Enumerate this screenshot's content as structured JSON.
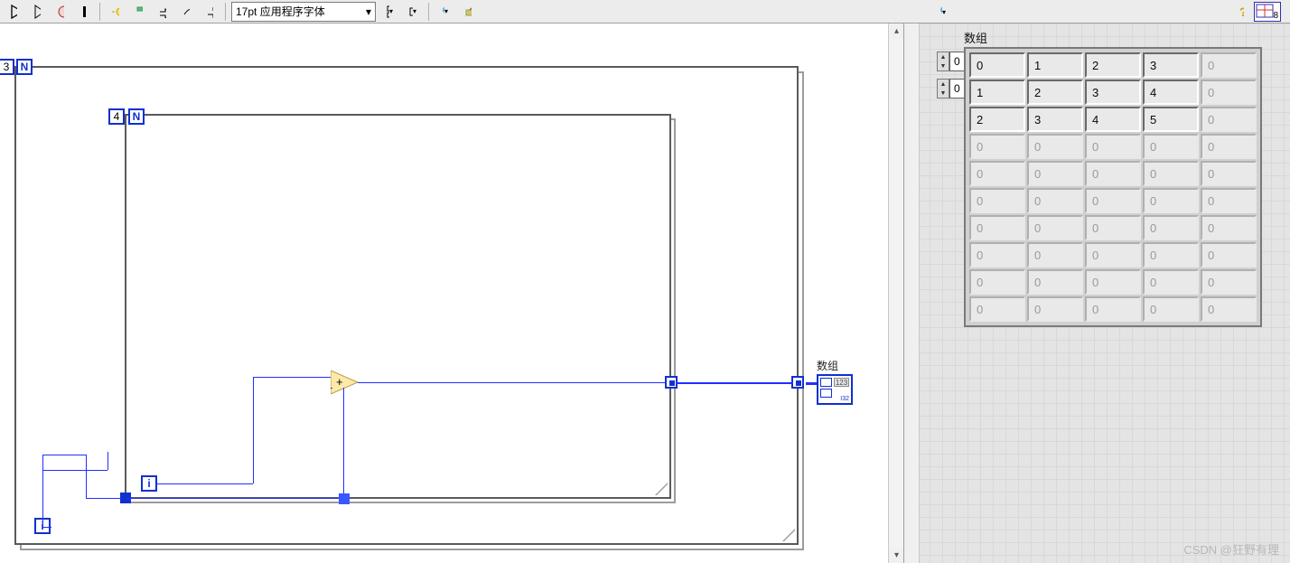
{
  "toolbar": {
    "font_selector": "17pt 应用程序字体",
    "badge_value": "8"
  },
  "diagram": {
    "outer_N_const": "3",
    "outer_N": "N",
    "outer_i": "i",
    "inner_N_const": "4",
    "inner_N": "N",
    "inner_i": "i",
    "add_op": "+",
    "indicator_label": "数组",
    "indicator_cell": "123",
    "indicator_sig": "I32"
  },
  "panel": {
    "array_label": "数组",
    "index_values": [
      "0",
      "0"
    ],
    "cols": 5,
    "rows": 10,
    "active_rows": 3,
    "active_cols": 4,
    "data": [
      [
        "0",
        "1",
        "2",
        "3",
        "0"
      ],
      [
        "1",
        "2",
        "3",
        "4",
        "0"
      ],
      [
        "2",
        "3",
        "4",
        "5",
        "0"
      ],
      [
        "0",
        "0",
        "0",
        "0",
        "0"
      ],
      [
        "0",
        "0",
        "0",
        "0",
        "0"
      ],
      [
        "0",
        "0",
        "0",
        "0",
        "0"
      ],
      [
        "0",
        "0",
        "0",
        "0",
        "0"
      ],
      [
        "0",
        "0",
        "0",
        "0",
        "0"
      ],
      [
        "0",
        "0",
        "0",
        "0",
        "0"
      ],
      [
        "0",
        "0",
        "0",
        "0",
        "0"
      ]
    ]
  },
  "watermark": "CSDN @狂野有理"
}
